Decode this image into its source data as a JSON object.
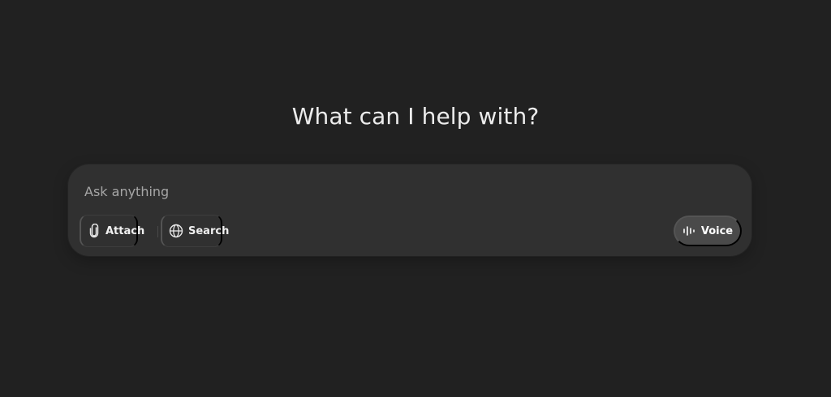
{
  "main": {
    "heading": "What can I help with?"
  },
  "composer": {
    "placeholder": "Ask anything",
    "value": "",
    "attach_label": "Attach",
    "attach_icon": "paperclip-icon",
    "search_label": "Search",
    "search_icon": "globe-icon",
    "voice_label": "Voice",
    "voice_icon": "waveform-icon"
  },
  "colors": {
    "background": "#212121",
    "composer": "#303030",
    "voice_button": "#4a4a4a",
    "text": "#ececec",
    "placeholder": "#a6a6a6"
  }
}
